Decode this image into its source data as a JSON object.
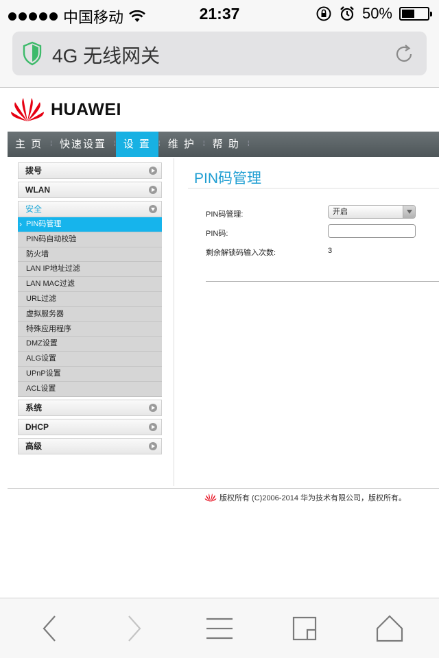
{
  "status": {
    "carrier": "中国移动",
    "time": "21:37",
    "battery": "50%",
    "battery_level": 0.5
  },
  "browser": {
    "title": "4G 无线网关"
  },
  "brand": {
    "name": "HUAWEI"
  },
  "nav": {
    "items": [
      {
        "label": "主 页"
      },
      {
        "label": "快速设置"
      },
      {
        "label": "设 置"
      },
      {
        "label": "维 护"
      },
      {
        "label": "帮 助"
      }
    ]
  },
  "sidebar": {
    "dial": "拨号",
    "wlan": "WLAN",
    "security": "安全",
    "security_items": [
      "PIN码管理",
      "PIN码自动校验",
      "防火墙",
      "LAN IP地址过滤",
      "LAN MAC过滤",
      "URL过滤",
      "虚拟服务器",
      "特殊应用程序",
      "DMZ设置",
      "ALG设置",
      "UPnP设置",
      "ACL设置"
    ],
    "system": "系统",
    "dhcp": "DHCP",
    "advanced": "高级"
  },
  "main": {
    "title": "PIN码管理",
    "pin_mgmt_label": "PIN码管理:",
    "pin_mgmt_value": "开启",
    "pin_label": "PIN码:",
    "remaining_label": "剩余解锁码输入次数:",
    "remaining_value": "3"
  },
  "footer": {
    "text": "版权所有 (C)2006-2014 华为技术有限公司，版权所有。"
  },
  "colors": {
    "accent": "#18b1e3",
    "nav_bg": "#5a6265",
    "title": "#1f9ed2",
    "brand_red": "#e60012"
  }
}
